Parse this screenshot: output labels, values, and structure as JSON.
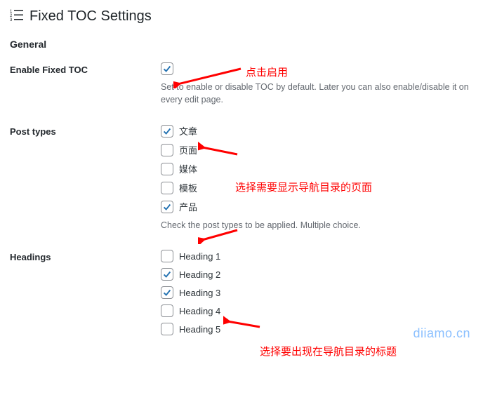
{
  "page": {
    "title": "Fixed TOC Settings",
    "section": "General"
  },
  "rows": {
    "enable": {
      "label": "Enable Fixed TOC",
      "checked": true,
      "desc": "Set to enable or disable TOC by default. Later you can also enable/disable it on every edit page."
    },
    "post_types": {
      "label": "Post types",
      "options": [
        {
          "label": "文章",
          "checked": true
        },
        {
          "label": "页面",
          "checked": false
        },
        {
          "label": "媒体",
          "checked": false
        },
        {
          "label": "模板",
          "checked": false
        },
        {
          "label": "产品",
          "checked": true
        }
      ],
      "desc": "Check the post types to be applied. Multiple choice."
    },
    "headings": {
      "label": "Headings",
      "options": [
        {
          "label": "Heading 1",
          "checked": false
        },
        {
          "label": "Heading 2",
          "checked": true
        },
        {
          "label": "Heading 3",
          "checked": true
        },
        {
          "label": "Heading 4",
          "checked": false
        },
        {
          "label": "Heading 5",
          "checked": false
        }
      ]
    }
  },
  "annotations": {
    "a1": "点击启用",
    "a2": "选择需要显示导航目录的页面",
    "a3": "选择要出现在导航目录的标题"
  },
  "watermark": "diiamo.cn",
  "colors": {
    "check": "#2271b1",
    "annot": "#ff0000"
  }
}
